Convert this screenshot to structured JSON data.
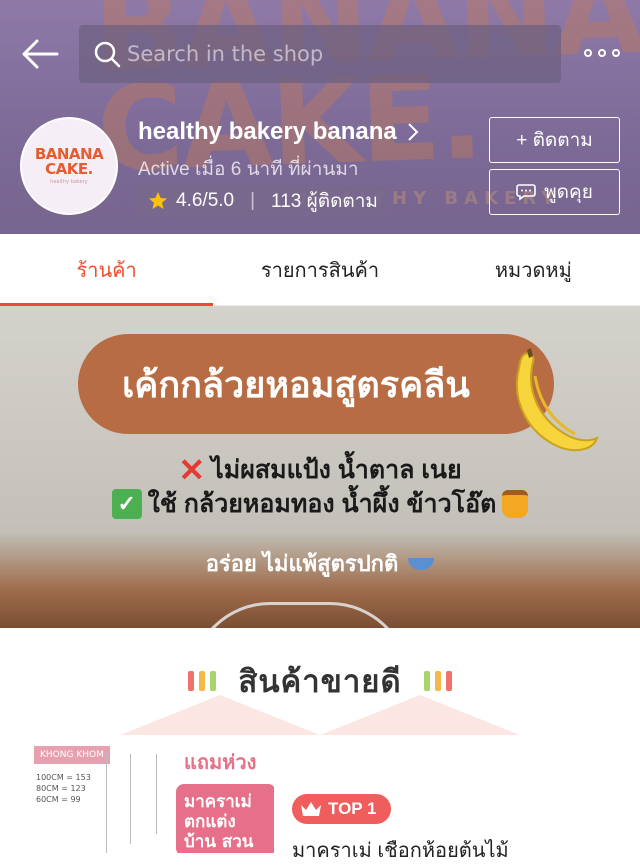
{
  "header": {
    "watermark": "BANANA CAKE.",
    "watermark_sub": "HEALTHY BAKERY",
    "search_placeholder": "Search in the shop",
    "more_icon": "more-dots-icon"
  },
  "shop": {
    "logo_line1": "BANANA",
    "logo_line2": "CAKE.",
    "logo_line3": "healthy bakery",
    "name": "healthy bakery banana",
    "active": "Active เมื่อ 6 นาที ที่ผ่านมา",
    "rating": "4.6/5.0",
    "followers": "113 ผู้ติดตาม",
    "follow_label": "+ ติดตาม",
    "chat_label": "พูดคุย"
  },
  "tabs": [
    {
      "label": "ร้านค้า",
      "active": true
    },
    {
      "label": "รายการสินค้า",
      "active": false
    },
    {
      "label": "หมวดหมู่",
      "active": false
    }
  ],
  "banner": {
    "title": "เค้กกล้วยหอมสูตรคลีน",
    "line1": "ไม่ผสมแป้ง น้ำตาล เนย",
    "line2": "ใช้ กล้วยหอมทอง น้ำผึ้ง ข้าวโอ๊ต",
    "line3": "อร่อย ไม่แพ้สูตรปกติ"
  },
  "best_sellers": {
    "title": "สินค้าขายดี",
    "bar_colors": [
      "#f0736a",
      "#f5b94a",
      "#a9d36b"
    ]
  },
  "product": {
    "img_tag": "KHONG KHOM",
    "img_dims": [
      "100CM = 153",
      "80CM = 123",
      "60CM = 99"
    ],
    "img_free": "แถมห่วง",
    "img_label": "มาคราเม่ ตกแต่ง บ้าน สวน ฯลฯ",
    "badge": "TOP 1",
    "name": "มาคราเม่ เชือกห้อยต้นไม้"
  },
  "colors": {
    "accent": "#ee4d2d",
    "header_bg": "#7d6a97",
    "banner_pill": "#b86c44",
    "top_badge": "#f05d5d"
  }
}
